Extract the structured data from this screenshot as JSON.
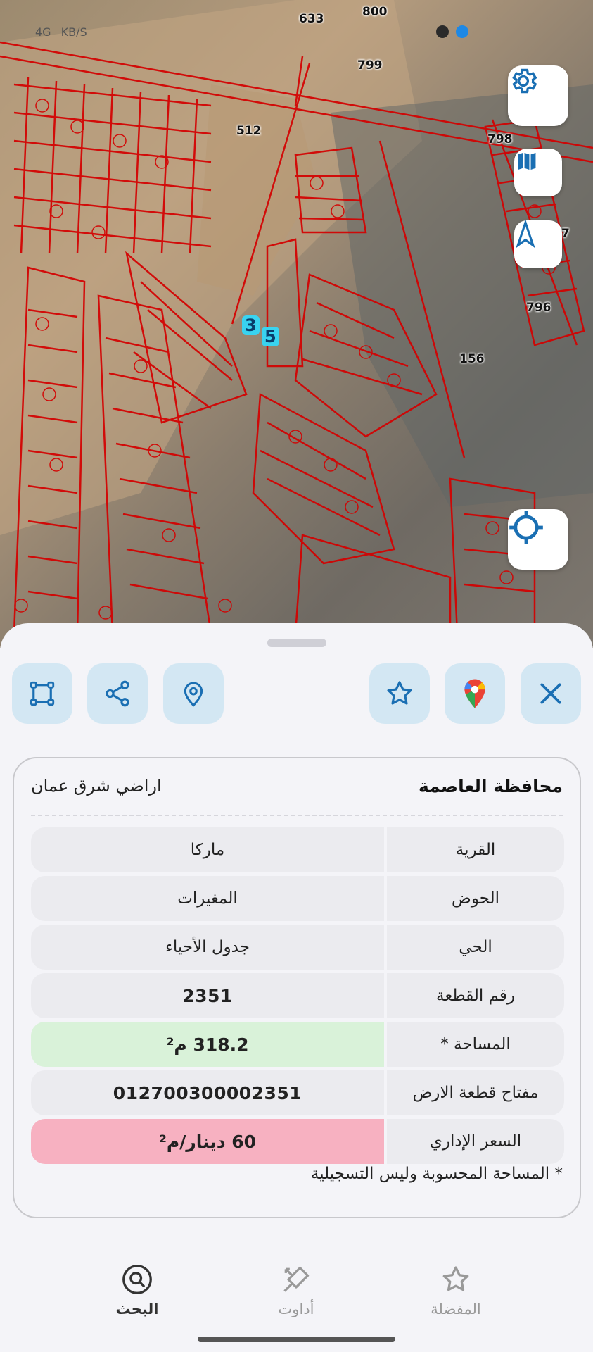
{
  "map": {
    "parcel_numbers": [
      "633",
      "800",
      "799",
      "512",
      "798",
      "7",
      "796",
      "156"
    ],
    "marker_labels": [
      "3",
      "5"
    ],
    "status": {
      "speed": "KB/S",
      "network": "4G"
    }
  },
  "actions": {
    "draw": "polygon-draw-icon",
    "share": "share-icon",
    "pin": "map-pin-icon",
    "favorite": "star-icon",
    "google_maps": "google-maps-icon",
    "close": "close-icon"
  },
  "card": {
    "governorate": "محافظة العاصمة",
    "region": "اراضي شرق عمان",
    "rows": [
      {
        "label": "القرية",
        "value": "ماركا"
      },
      {
        "label": "الحوض",
        "value": "المغيرات"
      },
      {
        "label": "الحي",
        "value": "جدول الأحياء"
      },
      {
        "label": "رقم القطعة",
        "value": "2351"
      },
      {
        "label": "المساحة *",
        "value": "318.2 م²"
      },
      {
        "label": "مفتاح قطعة الارض",
        "value": "012700300002351"
      },
      {
        "label": "السعر الإداري",
        "value": "60 دينار/م²"
      }
    ],
    "footnote": "* المساحة المحسوبة وليس التسجيلية"
  },
  "nav": {
    "search": "البحث",
    "tools": "أداوت",
    "favorites": "المفضلة"
  },
  "colors": {
    "accent": "#1a6fb3",
    "button_bg": "#d3e7f3",
    "area_green": "#d9f2d9",
    "price_pink": "#f7b1c1",
    "parcel_lines": "#d40000"
  }
}
